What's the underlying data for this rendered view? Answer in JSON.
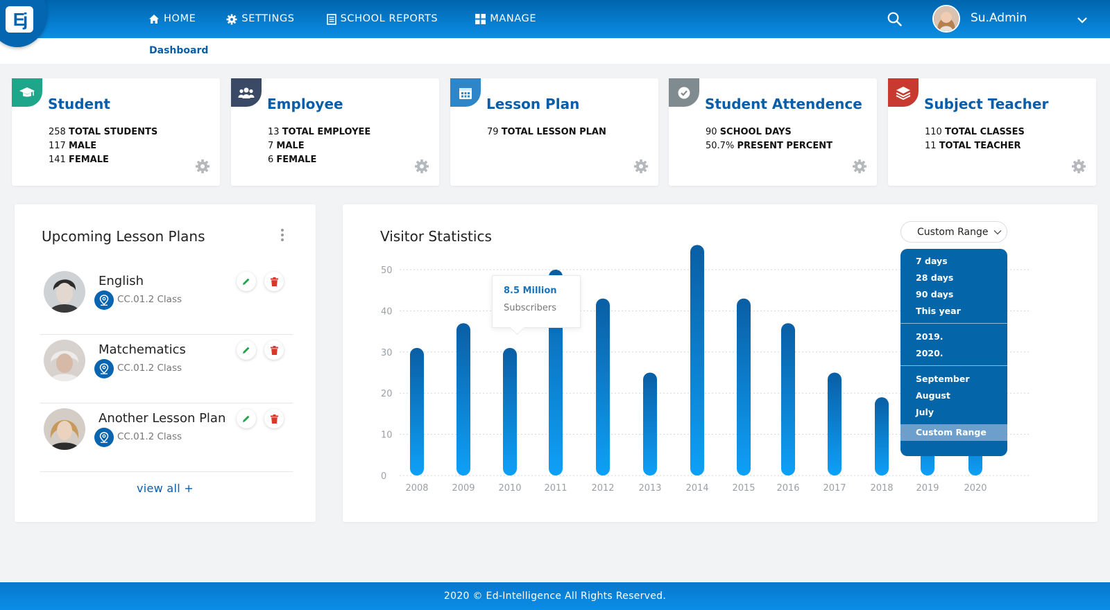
{
  "brand": {
    "logo_text": "Ej"
  },
  "nav": {
    "items": [
      {
        "label": "HOME",
        "icon": "home-icon"
      },
      {
        "label": "SETTINGS",
        "icon": "gear-icon"
      },
      {
        "label": "SCHOOL REPORTS",
        "icon": "report-icon"
      },
      {
        "label": "MANAGE",
        "icon": "grid-icon"
      }
    ]
  },
  "user": {
    "name": "Su.Admin"
  },
  "breadcrumb": {
    "label": "Dashboard"
  },
  "cards": [
    {
      "title": "Student",
      "color": "#1ea58a",
      "icon": "graduation-cap-icon",
      "lines": [
        {
          "value": "258",
          "label": "TOTAL STUDENTS"
        },
        {
          "value": "117",
          "label": "MALE"
        },
        {
          "value": "141",
          "label": "FEMALE"
        }
      ]
    },
    {
      "title": "Employee",
      "color": "#3a4a66",
      "icon": "people-icon",
      "lines": [
        {
          "value": "13",
          "label": "TOTAL EMPLOYEE"
        },
        {
          "value": "7",
          "label": "MALE"
        },
        {
          "value": "6",
          "label": "FEMALE"
        }
      ]
    },
    {
      "title": "Lesson Plan",
      "color": "#2e86c8",
      "icon": "calendar-icon",
      "lines": [
        {
          "value": "79",
          "label": "TOTAL LESSON PLAN"
        }
      ]
    },
    {
      "title": "Student Attendence",
      "color": "#7f8b8f",
      "icon": "check-badge-icon",
      "lines": [
        {
          "value": "90",
          "label": "SCHOOL DAYS"
        },
        {
          "value": "50.7%",
          "label": "PRESENT PERCENT"
        }
      ]
    },
    {
      "title": "Subject Teacher",
      "color": "#c8392f",
      "icon": "layers-icon",
      "lines": [
        {
          "value": "110",
          "label": "TOTAL CLASSES"
        },
        {
          "value": "11",
          "label": "TOTAL TEACHER"
        }
      ]
    }
  ],
  "lesson_plans": {
    "title": "Upcoming Lesson Plans",
    "items": [
      {
        "name": "English",
        "class": "CC.01.2 Class"
      },
      {
        "name": "Matchematics",
        "class": "CC.01.2 Class"
      },
      {
        "name": "Another Lesson Plan",
        "class": "CC.01.2 Class"
      }
    ],
    "view_all": "view all +"
  },
  "visitor": {
    "title": "Visitor Statistics",
    "range_label": "Custom Range",
    "tooltip": {
      "value": "8.5 Million",
      "label": "Subscribers"
    },
    "dropdown": {
      "group1": [
        "7 days",
        "28 days",
        "90 days",
        "This year"
      ],
      "group2": [
        "2019.",
        "2020."
      ],
      "group3": [
        "September",
        "August",
        "July"
      ],
      "active": "Custom Range"
    }
  },
  "chart_data": {
    "type": "bar",
    "categories": [
      "2008",
      "2009",
      "2010",
      "2011",
      "2012",
      "2013",
      "2014",
      "2015",
      "2016",
      "2017",
      "2018",
      "2019",
      "2020"
    ],
    "values": [
      31,
      37,
      31,
      50,
      43,
      25,
      56,
      43,
      37,
      25,
      19,
      18,
      16
    ],
    "ylim": [
      0,
      50
    ],
    "yticks": [
      0,
      10,
      20,
      30,
      40,
      50
    ],
    "grid": true,
    "colors": {
      "top": "#0a5ea4",
      "bottom": "#0ea0f7"
    }
  },
  "footer": {
    "text": "2020 © Ed-Intelligence All Rights Reserved."
  }
}
